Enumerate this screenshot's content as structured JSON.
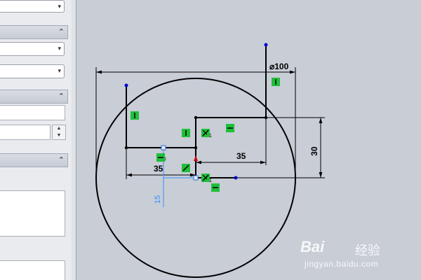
{
  "property_manager": {
    "groups": [
      {
        "collapse_glyph": "⌃"
      },
      {
        "collapse_glyph": "⌃"
      },
      {
        "collapse_glyph": "⌃"
      }
    ],
    "dropdown_chevron": "▾",
    "spinner_up": "▲",
    "spinner_down": "▼"
  },
  "sketch": {
    "dimensions": {
      "diameter": "⌀100",
      "horizontal_upper": "35",
      "horizontal_lower": "35",
      "vertical": "30",
      "preview": "15"
    },
    "relation_icons": [
      "vertical-relation-icon",
      "horizontal-relation-icon",
      "coincident-relation-icon",
      "midpoint-relation-icon"
    ],
    "colors": {
      "geometry": "#000000",
      "relation": "#1fbf3a",
      "preview": "#3a8fff",
      "point": "#0000d0",
      "origin": "#d00000"
    }
  },
  "watermark": {
    "brand": "Bai",
    "brand_cn": "经验",
    "url": "jingyan.baidu.com"
  }
}
